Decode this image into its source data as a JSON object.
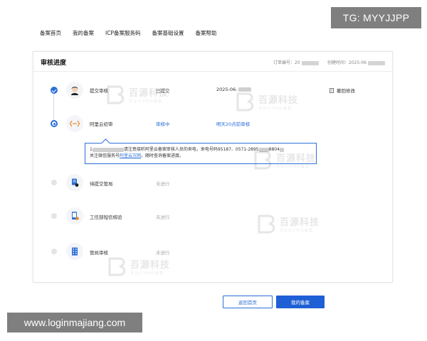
{
  "nav": {
    "items": [
      "备案首页",
      "我的备案",
      "ICP备案服务码",
      "备案基础设置",
      "备案帮助"
    ]
  },
  "card": {
    "title": "审核进度",
    "order_no_label": "订单编号：20",
    "created_label": "创建时间：2025-06"
  },
  "steps": [
    {
      "name": "提交审核",
      "status": "已提交",
      "extra": "2025-06-",
      "icon": "user-avatar-icon",
      "state": "done"
    },
    {
      "name": "阿里云初审",
      "status": "审核中",
      "extra": "明天20点前审核",
      "icon": "review-dots-icon",
      "state": "current"
    },
    {
      "name": "待提交管局",
      "status": "未进行",
      "extra": "",
      "icon": "document-submit-icon",
      "state": "pending"
    },
    {
      "name": "工信部短信核验",
      "status": "未进行",
      "extra": "",
      "icon": "sms-verify-icon",
      "state": "pending"
    },
    {
      "name": "管局审核",
      "status": "未进行",
      "extra": "",
      "icon": "building-icon",
      "state": "pending"
    }
  ],
  "revoke_label": "撤回修改",
  "tip": {
    "line1_prefix": "1",
    "line1_mid": "请注意接听阿里云备案审核人员的来电，来电号码95187、0571-2895",
    "line1_suffix": "8804",
    "line2_prefix": "关注微信服务号",
    "link": "阿里云万网",
    "line2_suffix": "，随时查询备案进度。"
  },
  "buttons": {
    "back": "返回首页",
    "mine": "我的备案"
  },
  "overlays": {
    "top_right": "TG: MYYJJPP",
    "bottom_left": "www.loginmajiang.com"
  },
  "watermark": {
    "text": "百源科技",
    "sub": "专业ICP代办备案"
  },
  "colors": {
    "accent": "#2b6fd6",
    "primary_button": "#1f5fd6",
    "overlay_bg": "#7f7f7f"
  }
}
